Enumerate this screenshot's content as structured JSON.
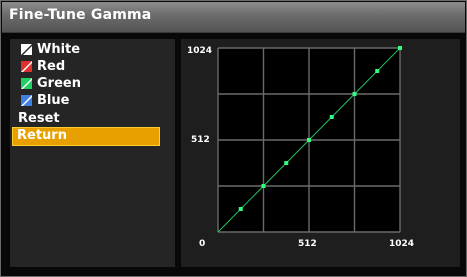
{
  "window": {
    "title": "Fine-Tune Gamma"
  },
  "menu": {
    "items": [
      {
        "label": "White",
        "swatch_color": "#ffffff"
      },
      {
        "label": "Red",
        "swatch_color": "#e03030"
      },
      {
        "label": "Green",
        "swatch_color": "#20d060"
      },
      {
        "label": "Blue",
        "swatch_color": "#4080e0"
      },
      {
        "label": "Reset"
      },
      {
        "label": "Return",
        "selected": true
      }
    ]
  },
  "graph": {
    "y_max_label": "1024",
    "y_mid_label": "512",
    "x_min_label": "0",
    "x_mid_label": "512",
    "x_max_label": "1024",
    "grid_divisions": 4,
    "line_color": "#20c060",
    "point_color": "#30ff80",
    "gamma_points": [
      {
        "input": 0,
        "output": 0
      },
      {
        "input": 128,
        "output": 128
      },
      {
        "input": 256,
        "output": 256
      },
      {
        "input": 384,
        "output": 384
      },
      {
        "input": 512,
        "output": 512
      },
      {
        "input": 640,
        "output": 640
      },
      {
        "input": 768,
        "output": 768
      },
      {
        "input": 896,
        "output": 896
      },
      {
        "input": 1024,
        "output": 1024
      }
    ]
  }
}
